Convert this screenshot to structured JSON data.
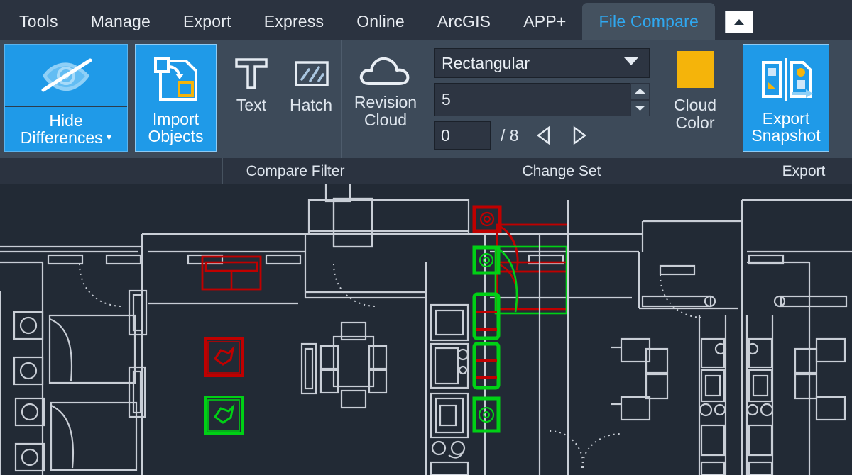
{
  "app": {
    "theme_bg": "#20262f",
    "ribbon_bg": "#3d4a59",
    "accent_blue": "#1f9ae8",
    "canvas_bg": "#222a35"
  },
  "tabs": [
    {
      "label": "Tools",
      "active": false
    },
    {
      "label": "Manage",
      "active": false
    },
    {
      "label": "Export",
      "active": false
    },
    {
      "label": "Express",
      "active": false
    },
    {
      "label": "Online",
      "active": false
    },
    {
      "label": "ArcGIS",
      "active": false
    },
    {
      "label": "APP+",
      "active": false
    },
    {
      "label": "File Compare",
      "active": true
    }
  ],
  "titlebar": {
    "restore_icon": "ribbon-minimize-icon"
  },
  "ribbon": {
    "hide_differences": {
      "label_line1": "Hide",
      "label_line2": "Differences",
      "caret": "▾",
      "icon": "eye-slash-icon",
      "active": true
    },
    "import_objects": {
      "label_line1": "Import",
      "label_line2": "Objects",
      "icon": "import-objects-icon",
      "active": true
    },
    "compare_filter": {
      "panel_title": "Compare Filter",
      "items": [
        {
          "label": "Text",
          "icon": "text-t-icon"
        },
        {
          "label": "Hatch",
          "icon": "hatch-icon"
        }
      ]
    },
    "change_set": {
      "panel_title": "Change Set",
      "revision_cloud": {
        "label_line1": "Revision",
        "label_line2": "Cloud",
        "icon": "cloud-icon"
      },
      "shape_dropdown": {
        "value": "Rectangular",
        "icon": "chevron-down-icon"
      },
      "size_spinner": {
        "value": "5",
        "up_icon": "spinner-up-icon",
        "down_icon": "spinner-down-icon"
      },
      "navigation": {
        "current": "0",
        "total_label": "/ 8",
        "prev_icon": "triangle-left-icon",
        "next_icon": "triangle-right-icon"
      },
      "cloud_color": {
        "label_line1": "Cloud",
        "label_line2": "Color",
        "swatch_color": "#f5b40a",
        "icon": "color-swatch"
      }
    },
    "export": {
      "panel_title": "Export",
      "export_snapshot": {
        "label_line1": "Export",
        "label_line2": "Snapshot",
        "icon": "export-snapshot-icon",
        "active": true
      }
    }
  },
  "drawing": {
    "name": "floor-plan-compare-view",
    "line_color": "#c9ced6",
    "deleted_color": "#c00000",
    "added_color": "#00d015",
    "legend": {
      "deleted": "deleted objects (red)",
      "added": "added objects (green)"
    }
  }
}
